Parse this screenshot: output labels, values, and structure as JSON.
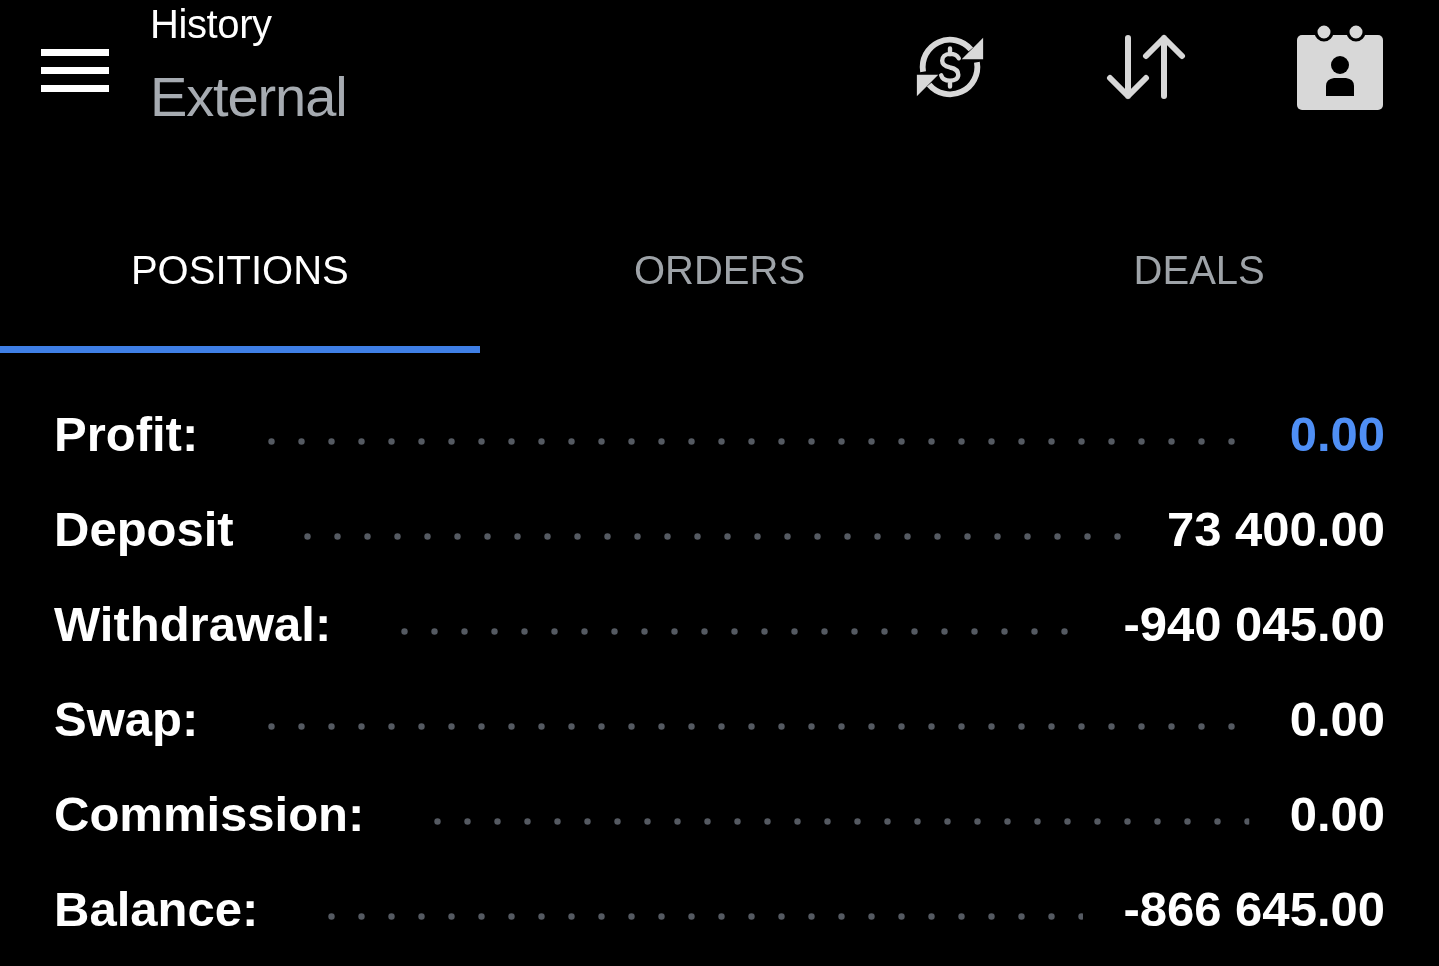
{
  "header": {
    "title": "History",
    "subtitle": "External"
  },
  "tabs": [
    {
      "label": "POSITIONS",
      "selected": true
    },
    {
      "label": "ORDERS",
      "selected": false
    },
    {
      "label": "DEALS",
      "selected": false
    }
  ],
  "summary": [
    {
      "label": "Profit:",
      "value": "0.00",
      "color": "#4f8ff5"
    },
    {
      "label": "Deposit",
      "value": "73 400.00",
      "color": "#ffffff"
    },
    {
      "label": "Withdrawal:",
      "value": "-940 045.00",
      "color": "#ffffff"
    },
    {
      "label": "Swap:",
      "value": "0.00",
      "color": "#ffffff"
    },
    {
      "label": "Commission:",
      "value": "0.00",
      "color": "#ffffff"
    },
    {
      "label": "Balance:",
      "value": "-866 645.00",
      "color": "#ffffff"
    }
  ]
}
